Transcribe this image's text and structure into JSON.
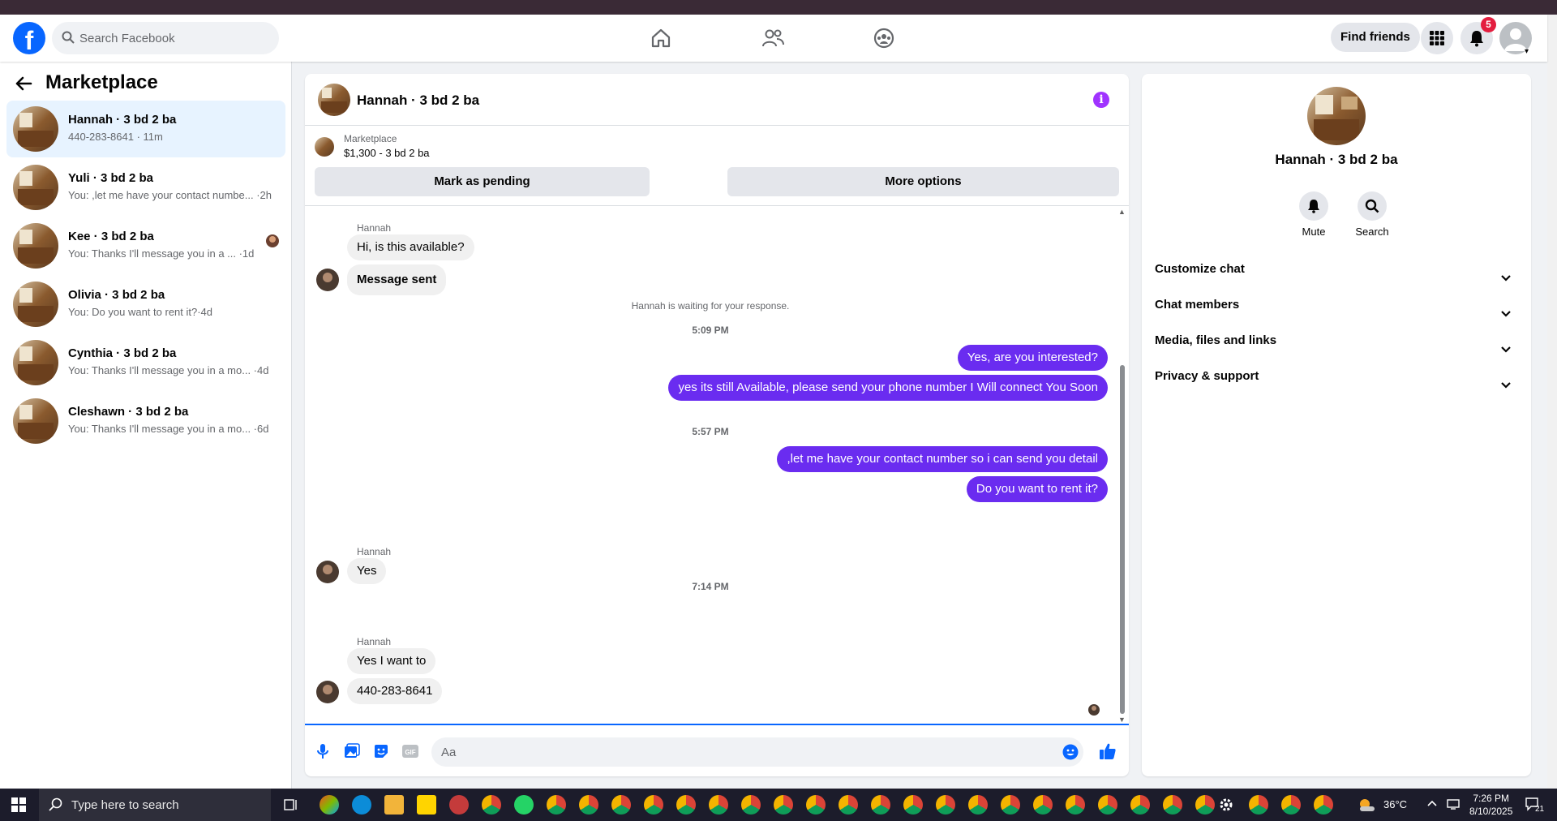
{
  "topnav": {
    "search_placeholder": "Search Facebook",
    "find_friends_label": "Find friends",
    "notifications_count": "5"
  },
  "marketplace": {
    "title": "Marketplace",
    "conversations": [
      {
        "name": "Hannah · 3 bd 2 ba",
        "preview": "440-283-8641 · 11m",
        "active": true
      },
      {
        "name": "Yuli · 3 bd 2 ba",
        "preview": "You: ,let me have your contact numbe... ·2h"
      },
      {
        "name": "Kee · 3 bd 2 ba",
        "preview": "You: Thanks I'll message you in a ... ·1d"
      },
      {
        "name": "Olivia · 3 bd 2 ba",
        "preview": "You: Do you want to rent it?·4d"
      },
      {
        "name": "Cynthia · 3 bd 2 ba",
        "preview": "You: Thanks I'll message you in a mo... ·4d"
      },
      {
        "name": "Cleshawn · 3 bd 2 ba",
        "preview": "You: Thanks I'll message you in a mo... ·6d"
      }
    ]
  },
  "chat": {
    "title": "Hannah · 3 bd 2 ba",
    "listing_category": "Marketplace",
    "listing_price": "$1,300 - 3 bd 2 ba",
    "mark_pending_label": "Mark as pending",
    "more_options_label": "More options",
    "sender_name": "Hannah",
    "messages": {
      "in1": "Hi, is this available?",
      "in2": "Message sent",
      "waiting_note": "Hannah is waiting for your response.",
      "ts1": "5:09 PM",
      "out1": "Yes, are you interested?",
      "out2": "yes its still Available, please send your phone number I Will connect You Soon",
      "ts2": "5:57 PM",
      "out3": ",let me have your contact number so i can send you detail",
      "out4": "Do you want to rent it?",
      "in3": "Yes",
      "ts3": "7:14 PM",
      "in4": "Yes I want to",
      "in5": "440-283-8641"
    },
    "composer_placeholder": "Aa"
  },
  "details": {
    "name": "Hannah · 3 bd 2 ba",
    "mute_label": "Mute",
    "search_label": "Search",
    "sections": [
      "Customize chat",
      "Chat members",
      "Media, files and links",
      "Privacy & support"
    ]
  },
  "taskbar": {
    "search_placeholder": "Type here to search",
    "temperature": "36°C",
    "time": "7:26 PM",
    "date": "8/10/2025",
    "notifications": "21"
  },
  "colors": {
    "brand_blue": "#0866ff",
    "outgoing_bubble": "#6a2cf0",
    "active_row": "#e7f3ff"
  }
}
